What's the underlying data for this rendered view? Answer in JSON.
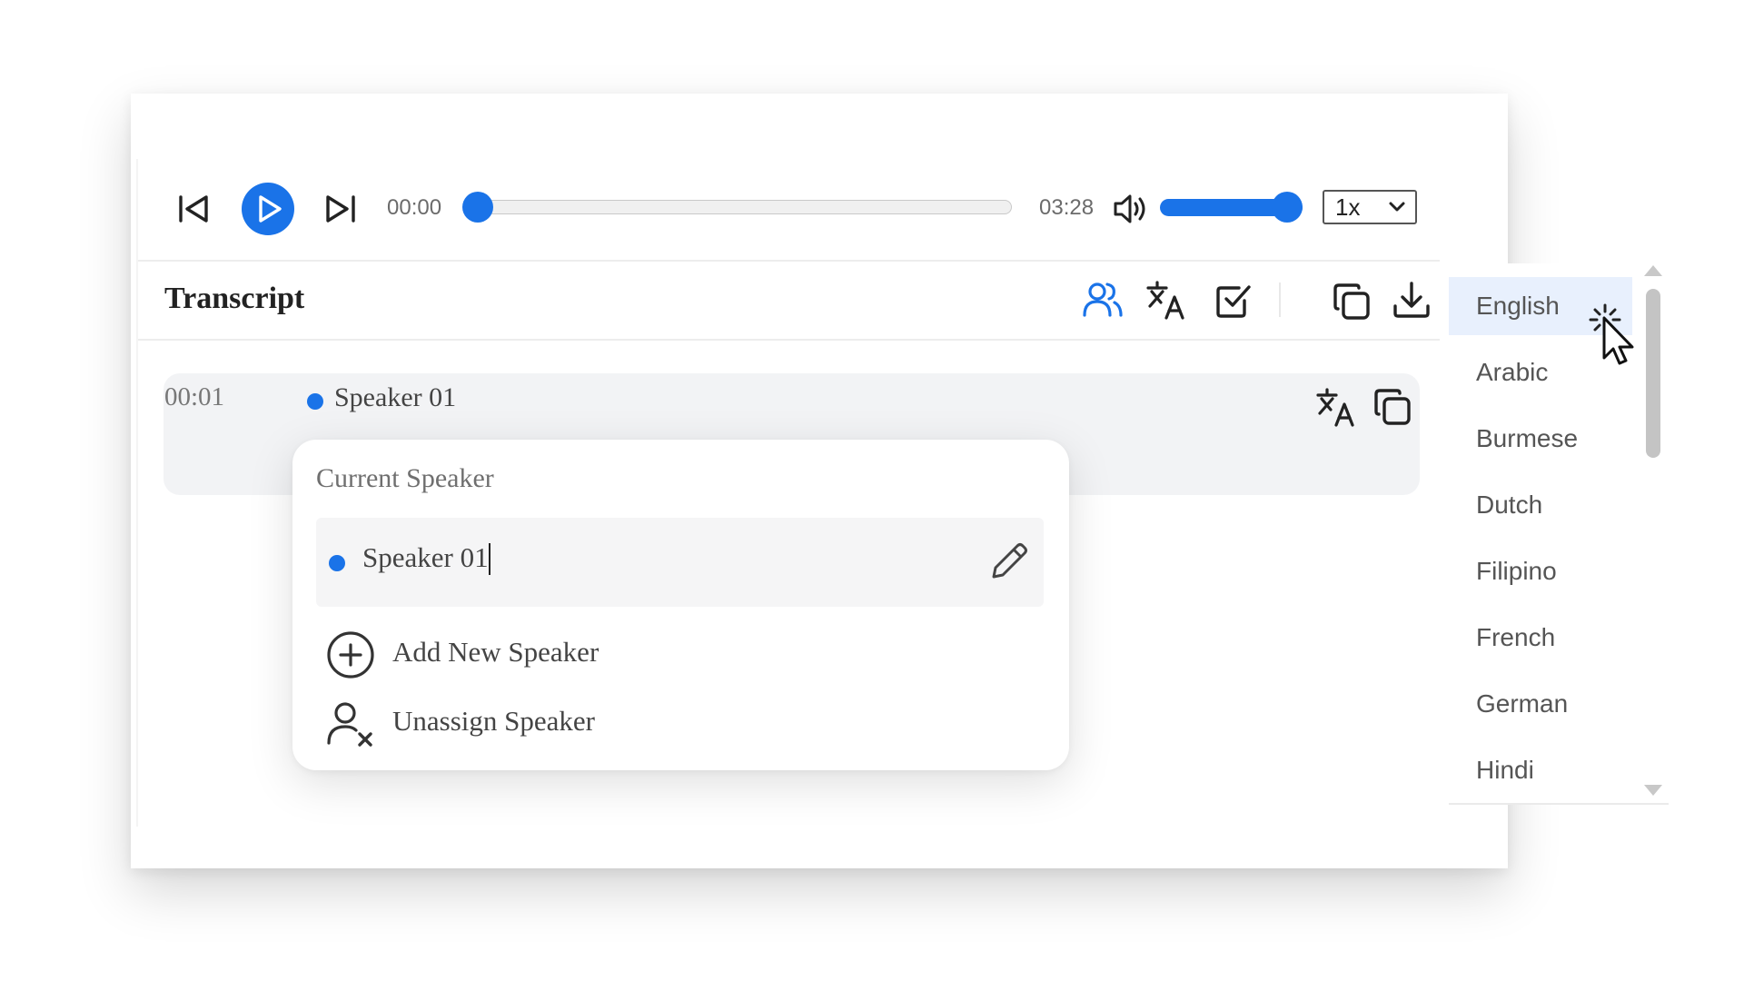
{
  "player": {
    "current_time": "00:00",
    "duration": "03:28",
    "progress_fraction": 0.0,
    "volume_fraction": 1.0,
    "speed": "1x",
    "accent_color": "#1a73e8"
  },
  "transcript": {
    "title": "Transcript",
    "toolbar_icons": [
      "speakers-icon",
      "translate-icon",
      "checkbox-icon",
      "copy-icon",
      "download-icon"
    ]
  },
  "segment": {
    "time": "00:01",
    "speaker": "Speaker 01"
  },
  "speaker_popup": {
    "label": "Current Speaker",
    "current_speaker_value": "Speaker 01",
    "add_new": "Add New Speaker",
    "unassign": "Unassign Speaker"
  },
  "language_menu": {
    "selected": "English",
    "items": [
      "English",
      "Arabic",
      "Burmese",
      "Dutch",
      "Filipino",
      "French",
      "German",
      "Hindi"
    ]
  }
}
